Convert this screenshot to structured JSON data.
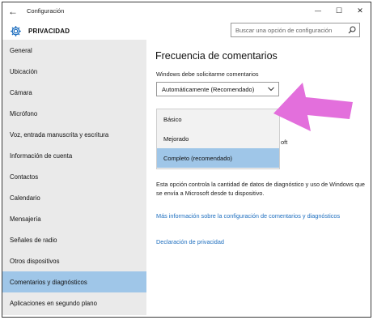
{
  "window": {
    "title": "Configuración",
    "back_glyph": "←",
    "minimize_glyph": "—",
    "maximize_glyph": "☐",
    "close_glyph": "✕"
  },
  "header": {
    "title": "PRIVACIDAD",
    "search_placeholder": "Buscar una opción de configuración",
    "icon": "gear-icon"
  },
  "sidebar": {
    "items": [
      {
        "label": "General"
      },
      {
        "label": "Ubicación"
      },
      {
        "label": "Cámara"
      },
      {
        "label": "Micrófono"
      },
      {
        "label": "Voz, entrada manuscrita y escritura"
      },
      {
        "label": "Información de cuenta"
      },
      {
        "label": "Contactos"
      },
      {
        "label": "Calendario"
      },
      {
        "label": "Mensajería"
      },
      {
        "label": "Señales de radio"
      },
      {
        "label": "Otros dispositivos"
      },
      {
        "label": "Comentarios y diagnósticos",
        "active": true
      },
      {
        "label": "Aplicaciones en segundo plano"
      }
    ]
  },
  "main": {
    "section_title": "Frecuencia de comentarios",
    "frequency_label": "Windows debe solicitarme comentarios",
    "frequency_value": "Automáticamente (Recomendado)",
    "dropdown_options": [
      {
        "label": "Básico"
      },
      {
        "label": "Mejorado"
      },
      {
        "label": "Completo (recomendado)",
        "selected": true
      }
    ],
    "occluded_text": "oft",
    "description": "Esta opción controla la cantidad de datos de diagnóstico y uso de Windows que se envía a Microsoft desde tu dispositivo.",
    "link_more_info": "Más información sobre la configuración de comentarios y diagnósticos",
    "link_privacy": "Declaración de privacidad"
  },
  "colors": {
    "selection": "#9fc6e8",
    "sidebar_bg": "#eaeaea",
    "link": "#1f6fbf",
    "annotation_arrow": "#e36fdc"
  }
}
